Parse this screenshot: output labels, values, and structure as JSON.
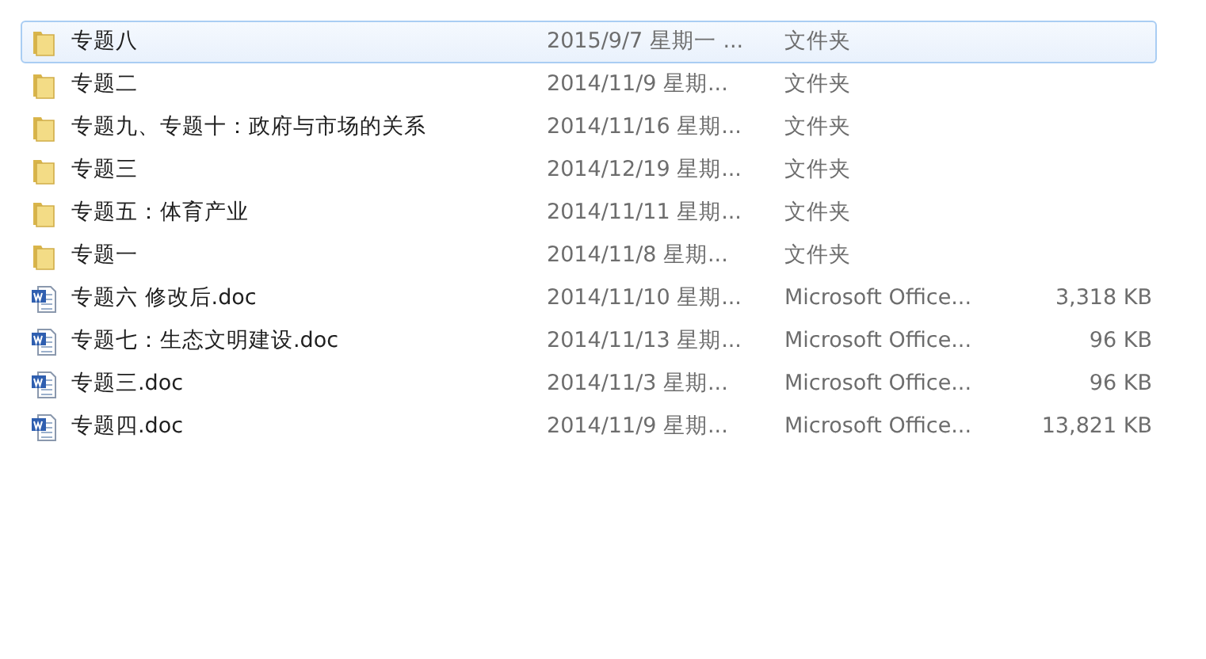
{
  "files": [
    {
      "kind": "folder",
      "name": "专题八",
      "date": "2015/9/7 星期一 ...",
      "type": "文件夹",
      "selected": true
    },
    {
      "kind": "folder",
      "name": "专题二",
      "date": "2014/11/9 星期...",
      "type": "文件夹",
      "selected": false
    },
    {
      "kind": "folder",
      "name": "专题九、专题十：政府与市场的关系",
      "date": "2014/11/16 星期...",
      "type": "文件夹",
      "selected": false
    },
    {
      "kind": "folder",
      "name": "专题三",
      "date": "2014/12/19 星期...",
      "type": "文件夹",
      "selected": false
    },
    {
      "kind": "folder",
      "name": "专题五：体育产业",
      "date": "2014/11/11 星期...",
      "type": "文件夹",
      "selected": false
    },
    {
      "kind": "folder",
      "name": "专题一",
      "date": "2014/11/8 星期...",
      "type": "文件夹",
      "selected": false
    },
    {
      "kind": "doc",
      "name": "专题六 修改后.doc",
      "date": "2014/11/10 星期...",
      "type": "Microsoft Office...",
      "size": "3,318 KB",
      "selected": false
    },
    {
      "kind": "doc",
      "name": "专题七：生态文明建设.doc",
      "date": "2014/11/13 星期...",
      "type": "Microsoft Office...",
      "size": "96 KB",
      "selected": false
    },
    {
      "kind": "doc",
      "name": "专题三.doc",
      "date": "2014/11/3 星期...",
      "type": "Microsoft Office...",
      "size": "96 KB",
      "selected": false
    },
    {
      "kind": "doc",
      "name": "专题四.doc",
      "date": "2014/11/9 星期...",
      "type": "Microsoft Office...",
      "size": "13,821 KB",
      "selected": false
    }
  ]
}
